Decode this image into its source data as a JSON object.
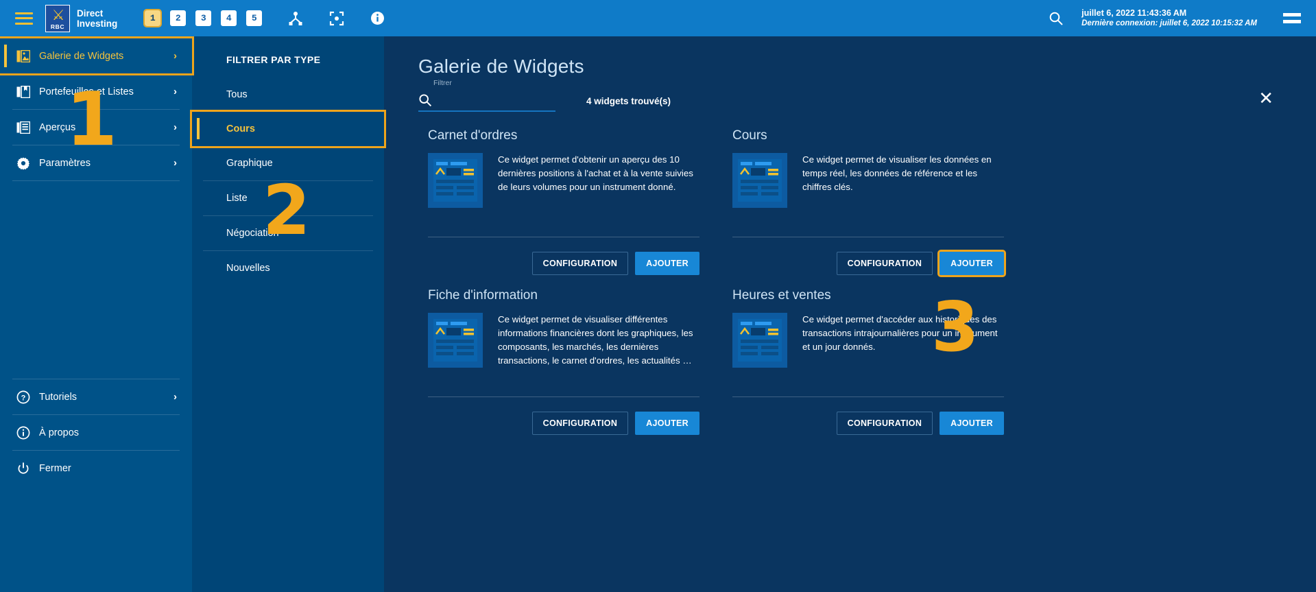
{
  "topbar": {
    "menu_icon": "hamburger-icon",
    "brand": {
      "line1": "Direct",
      "line2": "Investing",
      "logo_word": "RBC"
    },
    "tabs": [
      {
        "label": "1",
        "active": true
      },
      {
        "label": "2",
        "active": false
      },
      {
        "label": "3",
        "active": false
      },
      {
        "label": "4",
        "active": false
      },
      {
        "label": "5",
        "active": false
      }
    ],
    "icons": [
      "workspace-link-icon",
      "focus-frame-icon",
      "info-circle-icon",
      "search-icon"
    ],
    "datetime": "juillet 6, 2022 11:43:36 AM",
    "last_connection": "Dernière connexion: juillet 6, 2022 10:15:32 AM",
    "right_menu_icon": "equals-menu-icon"
  },
  "sidebar": {
    "items": [
      {
        "label": "Galerie de Widgets",
        "icon": "gallery-image-icon",
        "selected": true,
        "chevron": "›"
      },
      {
        "label": "Portefeuilles et Listes",
        "icon": "portfolios-icon",
        "selected": false,
        "chevron": "›"
      },
      {
        "label": "Aperçus",
        "icon": "overviews-icon",
        "selected": false,
        "chevron": "›"
      },
      {
        "label": "Paramètres",
        "icon": "gear-icon",
        "selected": false,
        "chevron": "›"
      }
    ],
    "bottom_items": [
      {
        "label": "Tutoriels",
        "icon": "question-circle-icon",
        "chevron": "›"
      },
      {
        "label": "À propos",
        "icon": "info-circle-icon",
        "chevron": ""
      },
      {
        "label": "Fermer",
        "icon": "power-icon",
        "chevron": ""
      }
    ]
  },
  "filter_panel": {
    "title": "FILTRER PAR TYPE",
    "items": [
      {
        "label": "Tous",
        "selected": false
      },
      {
        "label": "Cours",
        "selected": true
      },
      {
        "label": "Graphique",
        "selected": false
      },
      {
        "label": "Liste",
        "selected": false
      },
      {
        "label": "Négociation",
        "selected": false
      },
      {
        "label": "Nouvelles",
        "selected": false
      }
    ]
  },
  "main": {
    "page_title": "Galerie de Widgets",
    "close_icon": "close-icon",
    "search": {
      "label": "Filtrer",
      "value": "",
      "placeholder": "",
      "icon": "search-icon"
    },
    "result_count": "4 widgets trouvé(s)",
    "buttons": {
      "config": "CONFIGURATION",
      "add": "AJOUTER"
    },
    "widgets": [
      {
        "title": "Carnet d'ordres",
        "description": "Ce widget permet d'obtenir un aperçu des 10 dernières positions à l'achat et à la vente suivies de leurs volumes pour un instrument donné.",
        "thumbnail": "widget-preview-icon",
        "add_highlighted": false
      },
      {
        "title": "Cours",
        "description": "Ce widget permet de visualiser les données en temps réel, les données de référence et les chiffres clés.",
        "thumbnail": "widget-preview-icon",
        "add_highlighted": true
      },
      {
        "title": "Fiche d'information",
        "description": "Ce widget permet de visualiser différentes informations financières dont les graphiques, les composants, les marchés, les dernières transactions, le carnet d'ordres, les actualités …",
        "thumbnail": "widget-preview-icon",
        "add_highlighted": false
      },
      {
        "title": "Heures et ventes",
        "description": "Ce widget permet d'accéder aux historiques des transactions intrajournalières pour un instrument et un jour donnés.",
        "thumbnail": "widget-preview-icon",
        "add_highlighted": false
      }
    ]
  },
  "annotations": [
    {
      "label": "1"
    },
    {
      "label": "2"
    },
    {
      "label": "3"
    }
  ],
  "colors": {
    "topbar": "#0f7bc8",
    "sidebar": "#005288",
    "filter_panel": "#004577",
    "main": "#0a3560",
    "accent_gold": "#f5c33c",
    "highlight_orange": "#efa41b",
    "button_blue": "#1887d6"
  }
}
